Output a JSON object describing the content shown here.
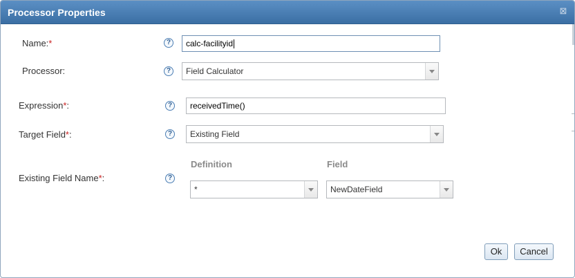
{
  "dialog": {
    "title": "Processor Properties",
    "close_glyph": "⊠"
  },
  "form": {
    "name": {
      "label": "Name:",
      "required": "*",
      "value": "calc-facilityid"
    },
    "processor": {
      "label": "Processor:",
      "value": "Field Calculator"
    },
    "expression": {
      "label": "Expression",
      "required": "*",
      "suffix": ":",
      "value": "receivedTime()"
    },
    "target_field": {
      "label": "Target Field",
      "required": "*",
      "suffix": ":",
      "value": "Existing Field"
    },
    "existing_field_name": {
      "label": "Existing Field Name",
      "required": "*",
      "suffix": ":",
      "definition_header": "Definition",
      "field_header": "Field",
      "definition_value": "*",
      "field_value": "NewDateField"
    },
    "help_glyph": "?"
  },
  "buttons": {
    "ok": "Ok",
    "cancel": "Cancel"
  }
}
